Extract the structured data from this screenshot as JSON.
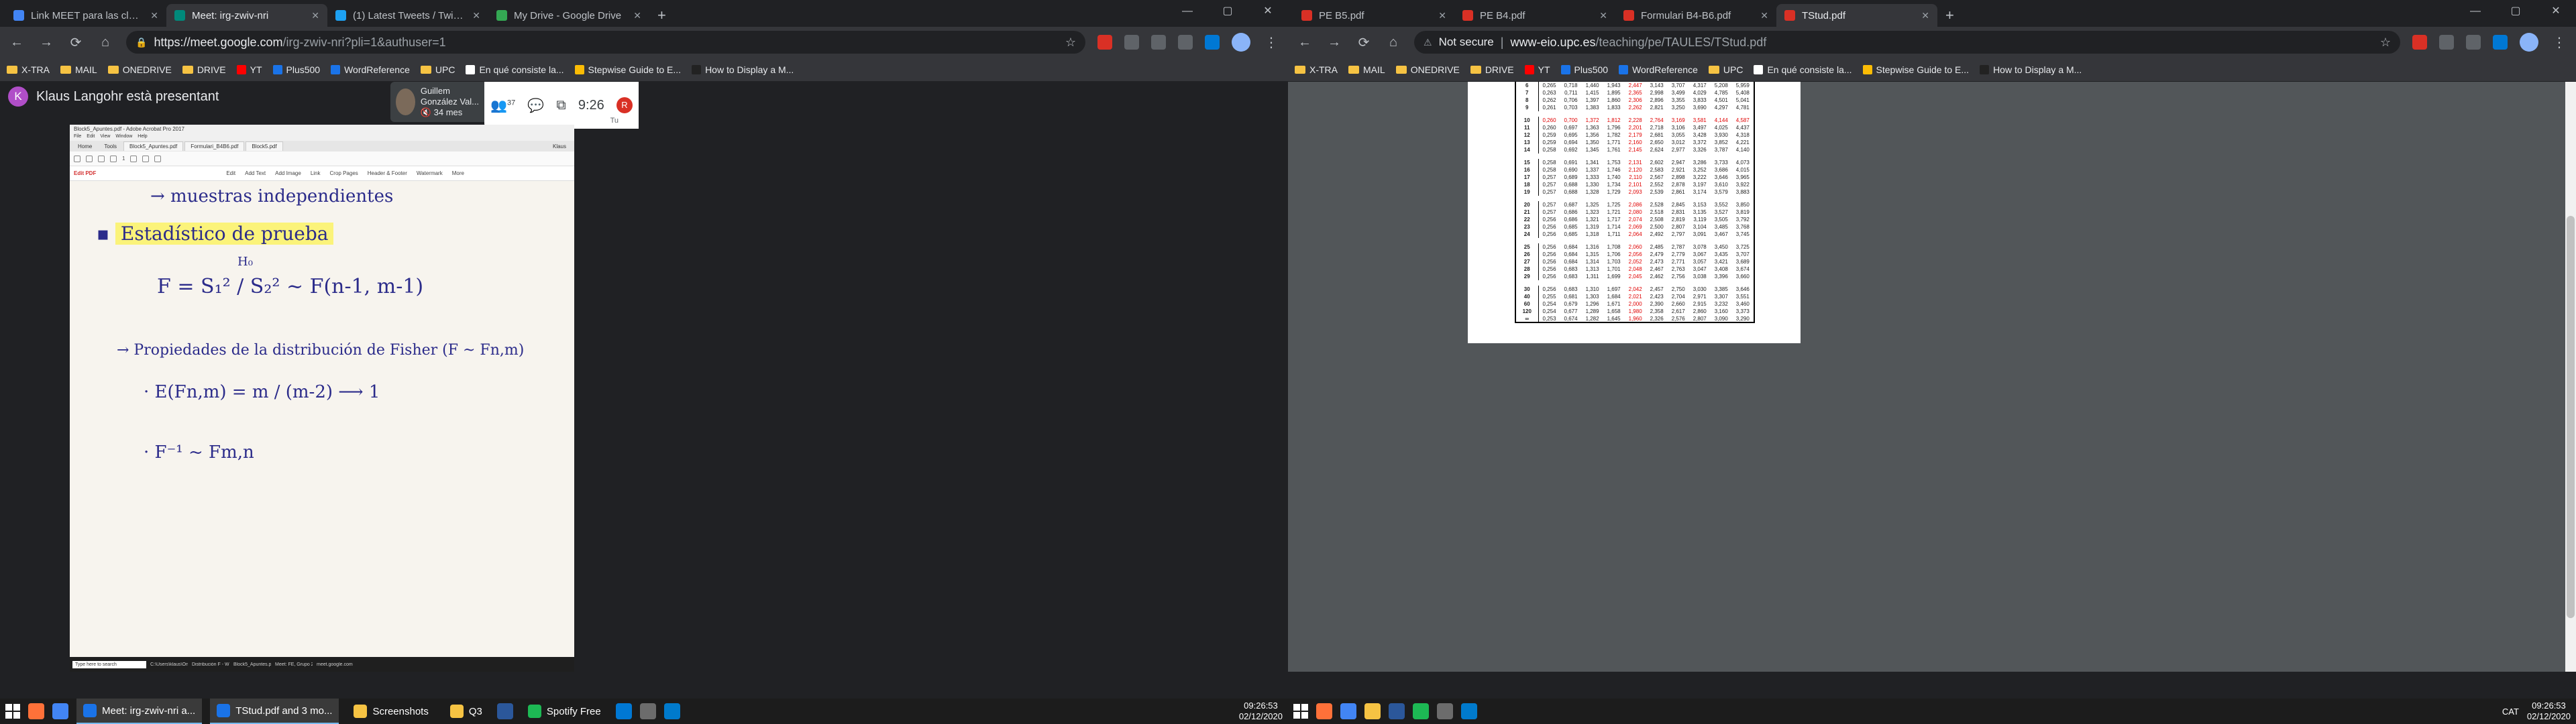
{
  "left": {
    "tabs": [
      {
        "label": "Link MEET para las clases del Gr",
        "fav": "#4285f4"
      },
      {
        "label": "Meet: irg-zwiv-nri",
        "fav": "#00897b",
        "active": true
      },
      {
        "label": "(1) Latest Tweets / Twitter",
        "fav": "#1da1f2"
      },
      {
        "label": "My Drive - Google Drive",
        "fav": "#34a853"
      }
    ],
    "url_host": "https://meet.google.com",
    "url_path": "/irg-zwiv-nri?pli=1&authuser=1",
    "bookmarks": [
      "X-TRA",
      "MAIL",
      "ONEDRIVE",
      "DRIVE",
      "YT",
      "Plus500",
      "WordReference",
      "UPC",
      "En qué consiste la...",
      "Stepwise Guide to E...",
      "How to Display a M..."
    ],
    "presenter": {
      "initial": "K",
      "text": "Klaus Langohr està presentant"
    },
    "guillem": {
      "name": "Guillem González Val...",
      "time": "34 mes"
    },
    "meet": {
      "participants": "37",
      "time": "9:26",
      "user": "R",
      "tu": "Tu"
    },
    "acrobat": {
      "title": "Block5_Apuntes.pdf - Adobe Acrobat Pro 2017",
      "menu": [
        "File",
        "Edit",
        "View",
        "Window",
        "Help"
      ],
      "tabs": [
        "Home",
        "Tools",
        "Block5_Apuntes.pdf",
        "Formulari_B4B6.pdf",
        "Block5.pdf"
      ],
      "user": "Klaus",
      "page": "1",
      "edit_label": "Edit PDF",
      "edit_tools": [
        "Edit",
        "Add Text",
        "Add Image",
        "Link",
        "Crop Pages",
        "Header & Footer",
        "Watermark",
        "More"
      ]
    },
    "notes": {
      "line1": "→ muestras independientes",
      "line2": "Estadístico de prueba",
      "formula": "F = S₁² / S₂² ~ F(n-1, m-1)",
      "h0": "H₀",
      "line3": "→ Propiedades de la distribución de Fisher (F ~ Fn,m)",
      "line4": "· E(Fn,m) = m / (m-2) ⟶ 1",
      "line5": "· F⁻¹ ~ Fm,n"
    },
    "mini_taskbar": {
      "search": "Type here to search",
      "items": [
        "C:\\Users\\klaus\\Onedri...",
        "Distribución F - Wik...",
        "Block5_Apuntes.pdf...",
        "Meet: FE, Grupo 20...",
        "meet.google.com is..."
      ]
    },
    "taskbar": [
      {
        "label": "Meet: irg-zwiv-nri a...",
        "color": "#1a73e8",
        "on": true
      },
      {
        "label": "TStud.pdf and 3 mo...",
        "color": "#1a73e8",
        "on": true
      },
      {
        "label": "Screenshots",
        "color": "#f6c343",
        "on": false
      },
      {
        "label": "Q3",
        "color": "#f6c343",
        "on": false
      }
    ],
    "spotify": "Spotify Free",
    "clock": {
      "time": "09:26:53",
      "date": "02/12/2020"
    }
  },
  "right": {
    "tabs": [
      {
        "label": "PE B5.pdf",
        "fav": "#d93025"
      },
      {
        "label": "PE B4.pdf",
        "fav": "#d93025"
      },
      {
        "label": "Formulari B4-B6.pdf",
        "fav": "#d93025"
      },
      {
        "label": "TStud.pdf",
        "fav": "#d93025",
        "active": true
      }
    ],
    "not_secure": "Not secure",
    "url_host": "www-eio.upc.es",
    "url_path": "/teaching/pe/TAULES/TStud.pdf",
    "bookmarks": [
      "X-TRA",
      "MAIL",
      "ONEDRIVE",
      "DRIVE",
      "YT",
      "Plus500",
      "WordReference",
      "UPC",
      "En qué consiste la...",
      "Stepwise Guide to E...",
      "How to Display a M..."
    ],
    "table": {
      "rows": [
        [
          "6",
          "0,265",
          "0,718",
          "1,440",
          "1,943",
          "2,447",
          "3,143",
          "3,707",
          "4,317",
          "5,208",
          "5,959"
        ],
        [
          "7",
          "0,263",
          "0,711",
          "1,415",
          "1,895",
          "2,365",
          "2,998",
          "3,499",
          "4,029",
          "4,785",
          "5,408"
        ],
        [
          "8",
          "0,262",
          "0,706",
          "1,397",
          "1,860",
          "2,306",
          "2,896",
          "3,355",
          "3,833",
          "4,501",
          "5,041"
        ],
        [
          "9",
          "0,261",
          "0,703",
          "1,383",
          "1,833",
          "2,262",
          "2,821",
          "3,250",
          "3,690",
          "4,297",
          "4,781"
        ],
        "gap",
        [
          "10",
          "0,260",
          "0,700",
          "1,372",
          "1,812",
          "2,228",
          "2,764",
          "3,169",
          "3,581",
          "4,144",
          "4,587"
        ],
        [
          "11",
          "0,260",
          "0,697",
          "1,363",
          "1,796",
          "2,201",
          "2,718",
          "3,106",
          "3,497",
          "4,025",
          "4,437"
        ],
        [
          "12",
          "0,259",
          "0,695",
          "1,356",
          "1,782",
          "2,179",
          "2,681",
          "3,055",
          "3,428",
          "3,930",
          "4,318"
        ],
        [
          "13",
          "0,259",
          "0,694",
          "1,350",
          "1,771",
          "2,160",
          "2,650",
          "3,012",
          "3,372",
          "3,852",
          "4,221"
        ],
        [
          "14",
          "0,258",
          "0,692",
          "1,345",
          "1,761",
          "2,145",
          "2,624",
          "2,977",
          "3,326",
          "3,787",
          "4,140"
        ],
        "gap",
        [
          "15",
          "0,258",
          "0,691",
          "1,341",
          "1,753",
          "2,131",
          "2,602",
          "2,947",
          "3,286",
          "3,733",
          "4,073"
        ],
        [
          "16",
          "0,258",
          "0,690",
          "1,337",
          "1,746",
          "2,120",
          "2,583",
          "2,921",
          "3,252",
          "3,686",
          "4,015"
        ],
        [
          "17",
          "0,257",
          "0,689",
          "1,333",
          "1,740",
          "2,110",
          "2,567",
          "2,898",
          "3,222",
          "3,646",
          "3,965"
        ],
        [
          "18",
          "0,257",
          "0,688",
          "1,330",
          "1,734",
          "2,101",
          "2,552",
          "2,878",
          "3,197",
          "3,610",
          "3,922"
        ],
        [
          "19",
          "0,257",
          "0,688",
          "1,328",
          "1,729",
          "2,093",
          "2,539",
          "2,861",
          "3,174",
          "3,579",
          "3,883"
        ],
        "gap",
        [
          "20",
          "0,257",
          "0,687",
          "1,325",
          "1,725",
          "2,086",
          "2,528",
          "2,845",
          "3,153",
          "3,552",
          "3,850"
        ],
        [
          "21",
          "0,257",
          "0,686",
          "1,323",
          "1,721",
          "2,080",
          "2,518",
          "2,831",
          "3,135",
          "3,527",
          "3,819"
        ],
        [
          "22",
          "0,256",
          "0,686",
          "1,321",
          "1,717",
          "2,074",
          "2,508",
          "2,819",
          "3,119",
          "3,505",
          "3,792"
        ],
        [
          "23",
          "0,256",
          "0,685",
          "1,319",
          "1,714",
          "2,069",
          "2,500",
          "2,807",
          "3,104",
          "3,485",
          "3,768"
        ],
        [
          "24",
          "0,256",
          "0,685",
          "1,318",
          "1,711",
          "2,064",
          "2,492",
          "2,797",
          "3,091",
          "3,467",
          "3,745"
        ],
        "gap",
        [
          "25",
          "0,256",
          "0,684",
          "1,316",
          "1,708",
          "2,060",
          "2,485",
          "2,787",
          "3,078",
          "3,450",
          "3,725"
        ],
        [
          "26",
          "0,256",
          "0,684",
          "1,315",
          "1,706",
          "2,056",
          "2,479",
          "2,779",
          "3,067",
          "3,435",
          "3,707"
        ],
        [
          "27",
          "0,256",
          "0,684",
          "1,314",
          "1,703",
          "2,052",
          "2,473",
          "2,771",
          "3,057",
          "3,421",
          "3,689"
        ],
        [
          "28",
          "0,256",
          "0,683",
          "1,313",
          "1,701",
          "2,048",
          "2,467",
          "2,763",
          "3,047",
          "3,408",
          "3,674"
        ],
        [
          "29",
          "0,256",
          "0,683",
          "1,311",
          "1,699",
          "2,045",
          "2,462",
          "2,756",
          "3,038",
          "3,396",
          "3,660"
        ],
        "gap",
        [
          "30",
          "0,256",
          "0,683",
          "1,310",
          "1,697",
          "2,042",
          "2,457",
          "2,750",
          "3,030",
          "3,385",
          "3,646"
        ],
        [
          "40",
          "0,255",
          "0,681",
          "1,303",
          "1,684",
          "2,021",
          "2,423",
          "2,704",
          "2,971",
          "3,307",
          "3,551"
        ],
        [
          "60",
          "0,254",
          "0,679",
          "1,296",
          "1,671",
          "2,000",
          "2,390",
          "2,660",
          "2,915",
          "3,232",
          "3,460"
        ],
        [
          "120",
          "0,254",
          "0,677",
          "1,289",
          "1,658",
          "1,980",
          "2,358",
          "2,617",
          "2,860",
          "3,160",
          "3,373"
        ],
        [
          "∞",
          "0,253",
          "0,674",
          "1,282",
          "1,645",
          "1,960",
          "2,326",
          "2,576",
          "2,807",
          "3,090",
          "3,290"
        ]
      ],
      "red_col": 5,
      "red_row": "10"
    },
    "tray_lang": "CAT",
    "clock": {
      "time": "09:26:53",
      "date": "02/12/2020"
    }
  },
  "colors": {
    "chrome_dark": "#202124",
    "chrome_toolbar": "#35363a",
    "red_value": "#e00000",
    "highlight": "#fbf37a",
    "ink": "#2b2b8a"
  }
}
